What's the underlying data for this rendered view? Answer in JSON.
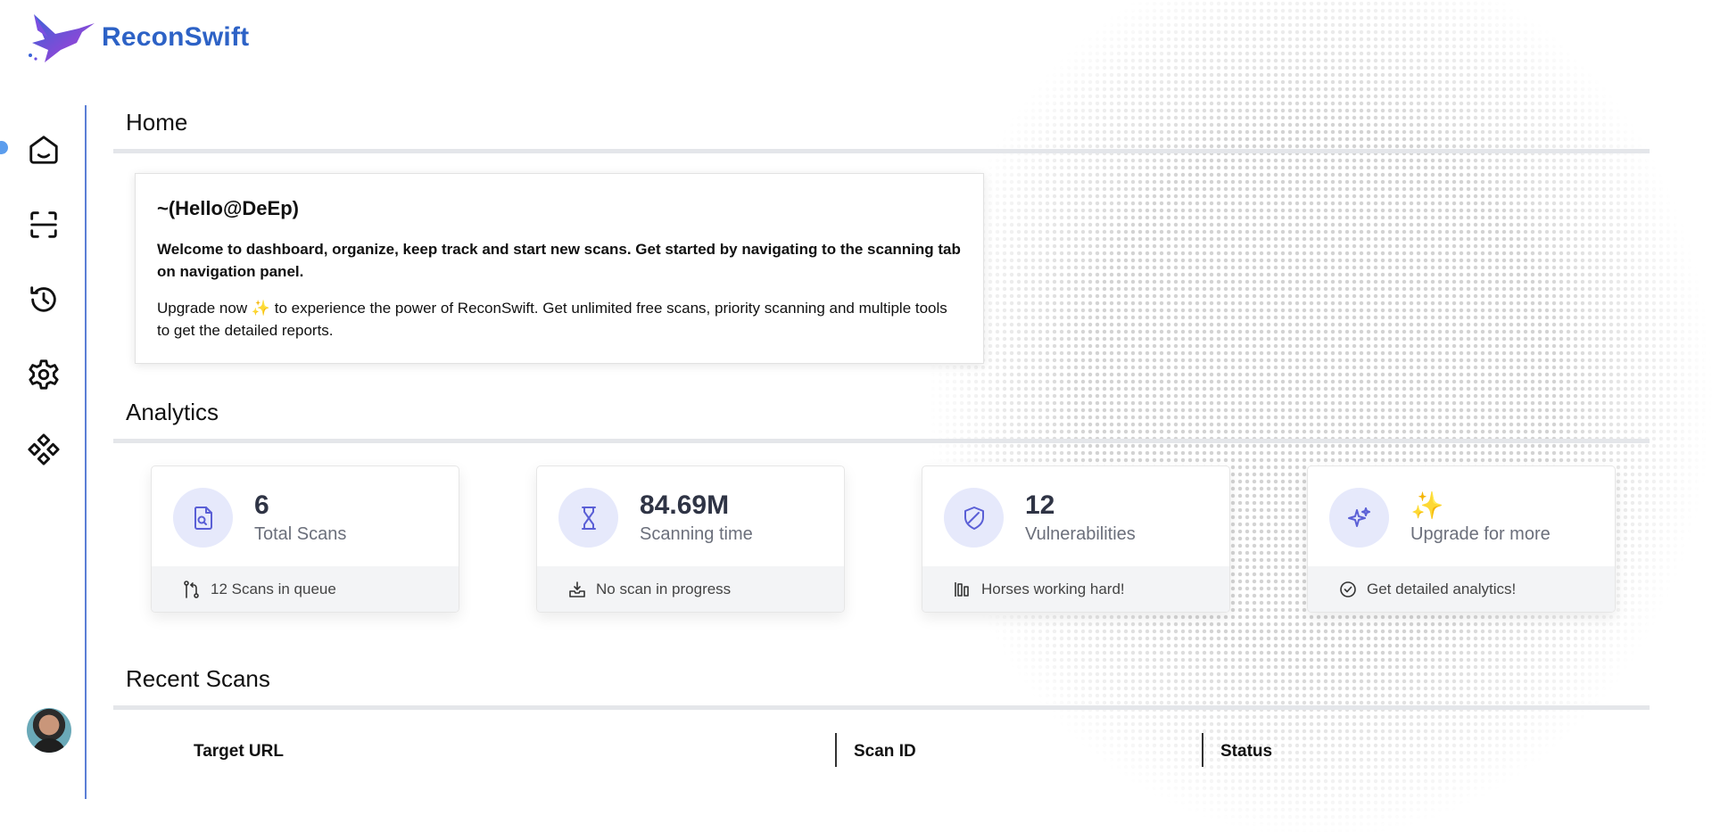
{
  "app": {
    "name": "ReconSwift"
  },
  "sidebar": {
    "items": [
      {
        "icon": "home-icon"
      },
      {
        "icon": "scan-icon"
      },
      {
        "icon": "history-icon"
      },
      {
        "icon": "gear-icon"
      },
      {
        "icon": "integrations-icon"
      }
    ],
    "active_index": 0
  },
  "home": {
    "title": "Home",
    "welcome": {
      "greeting": "~(Hello@DeEp)",
      "lead": "Welcome to dashboard, organize, keep track and start new scans. Get started by navigating to the scanning tab on navigation panel.",
      "upgrade_before": "Upgrade now ",
      "upgrade_emoji": "✨",
      "upgrade_after": " to experience the power of ReconSwift. Get unlimited free scans, priority scanning and multiple tools to get the detailed reports."
    }
  },
  "analytics": {
    "title": "Analytics",
    "cards": [
      {
        "value": "6",
        "label": "Total Scans",
        "footer": "12 Scans in queue",
        "icon": "document-search-icon",
        "footer_icon": "queue-icon"
      },
      {
        "value": "84.69M",
        "label": "Scanning time",
        "footer": "No scan in progress",
        "icon": "hourglass-icon",
        "footer_icon": "inbox-icon"
      },
      {
        "value": "12",
        "label": "Vulnerabilities",
        "footer": "Horses working hard!",
        "icon": "shield-icon",
        "footer_icon": "bars-icon"
      },
      {
        "value": "✨",
        "label": "Upgrade for more",
        "footer": "Get detailed analytics!",
        "icon": "sparkles-icon",
        "footer_icon": "check-circle-icon"
      }
    ]
  },
  "recent": {
    "title": "Recent Scans",
    "columns": [
      "Target URL",
      "Scan ID",
      "Status"
    ]
  },
  "colors": {
    "brand": "#2d62c6",
    "accent": "#5b7fd6",
    "icon_bg": "#e6e9fb"
  }
}
